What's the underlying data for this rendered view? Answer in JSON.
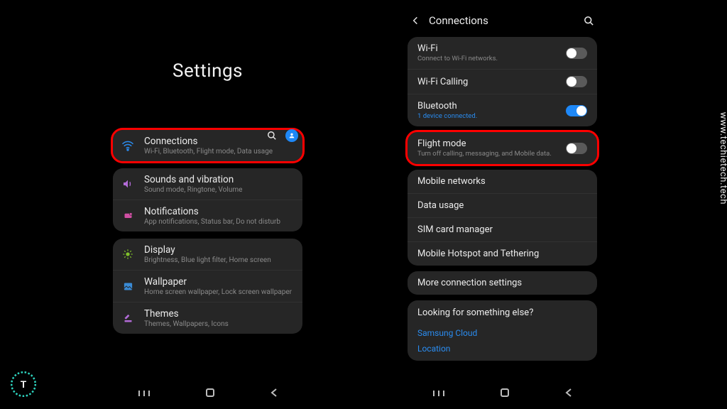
{
  "watermark": "www.techietech.tech",
  "left": {
    "title": "Settings",
    "groups": [
      {
        "highlighted": true,
        "rows": [
          {
            "icon": "wifi",
            "iconColor": "#2a8cf0",
            "title": "Connections",
            "sub": "Wi-Fi, Bluetooth, Flight mode, Data usage"
          }
        ]
      },
      {
        "rows": [
          {
            "icon": "sound",
            "iconColor": "#b26bd7",
            "title": "Sounds and vibration",
            "sub": "Sound mode, Ringtone, Volume"
          },
          {
            "icon": "bell",
            "iconColor": "#d04fa3",
            "title": "Notifications",
            "sub": "App notifications, Status bar, Do not disturb"
          }
        ]
      },
      {
        "rows": [
          {
            "icon": "display",
            "iconColor": "#7fbf2a",
            "title": "Display",
            "sub": "Brightness, Blue light filter, Home screen"
          },
          {
            "icon": "wallpaper",
            "iconColor": "#3a8bd6",
            "title": "Wallpaper",
            "sub": "Home screen wallpaper, Lock screen wallpaper"
          },
          {
            "icon": "themes",
            "iconColor": "#b26bd7",
            "title": "Themes",
            "sub": "Themes, Wallpapers, Icons"
          }
        ]
      }
    ]
  },
  "right": {
    "title": "Connections",
    "group1": [
      {
        "title": "Wi-Fi",
        "sub": "Connect to Wi-Fi networks.",
        "subBlue": false,
        "toggle": false
      },
      {
        "title": "Wi-Fi Calling",
        "sub": "",
        "toggle": false
      },
      {
        "title": "Bluetooth",
        "sub": "1 device connected.",
        "subBlue": true,
        "toggle": true
      }
    ],
    "flight": {
      "title": "Flight mode",
      "sub": "Turn off calling, messaging, and Mobile data.",
      "toggle": false
    },
    "group3": [
      {
        "title": "Mobile networks"
      },
      {
        "title": "Data usage"
      },
      {
        "title": "SIM card manager"
      },
      {
        "title": "Mobile Hotspot and Tethering"
      }
    ],
    "more": "More connection settings",
    "looking": {
      "header": "Looking for something else?",
      "links": [
        "Samsung Cloud",
        "Location"
      ]
    }
  }
}
